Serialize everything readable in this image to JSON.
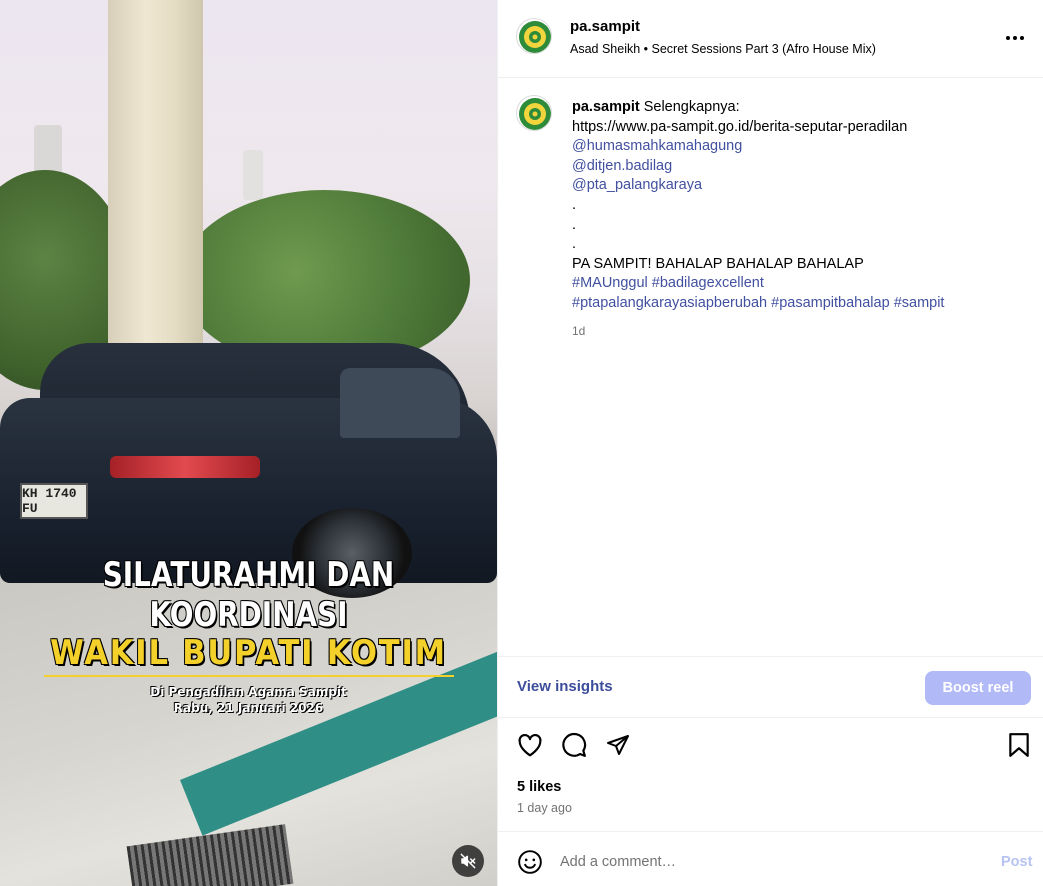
{
  "video": {
    "plate_text": "KH 1740 FU",
    "caption_line1": "SILATURAHMI DAN KOORDINASI",
    "caption_line2": "WAKIL BUPATI KOTIM",
    "caption_line3": "Di Pengadilan Agama Sampit",
    "caption_line4": "Rabu, 21 Januari 2026",
    "mute_icon": "speaker-muted-icon"
  },
  "header": {
    "username": "pa.sampit",
    "audio": "Asad Sheikh • Secret Sessions Part 3 (Afro House Mix)",
    "more_icon": "more-horizontal-icon"
  },
  "caption": {
    "username": "pa.sampit",
    "intro": "Selengkapnya:",
    "link": "https://www.pa-sampit.go.id/berita-seputar-peradilan",
    "mentions": [
      "@humasmahkamahagung",
      "@ditjen.badilag",
      "@pta_palangkaraya"
    ],
    "dots": [
      ".",
      ".",
      "."
    ],
    "slogan": "PA SAMPIT! BAHALAP BAHALAP BAHALAP",
    "hashtags_line1": [
      "#MAUnggul",
      "#badilagexcellent"
    ],
    "hashtags_line2": [
      "#ptapalangkarayasiapberubah",
      "#pasampitbahalap",
      "#sampit"
    ],
    "time": "1d"
  },
  "insights": {
    "view_label": "View insights",
    "boost_label": "Boost reel"
  },
  "actions": {
    "icons": [
      "heart-icon",
      "comment-icon",
      "share-icon",
      "bookmark-icon"
    ],
    "likes": "5 likes",
    "time_ago": "1 day ago"
  },
  "comment": {
    "placeholder": "Add a comment…",
    "post_label": "Post",
    "emoji_icon": "emoji-icon"
  },
  "colors": {
    "link_blue": "#4150a0",
    "insights_blue": "#3c4d9c",
    "boost_bg": "#b1b9f7",
    "post_disabled": "#b6c3f0",
    "muted_text": "#737373",
    "caption_yellow": "#f4d02a"
  }
}
